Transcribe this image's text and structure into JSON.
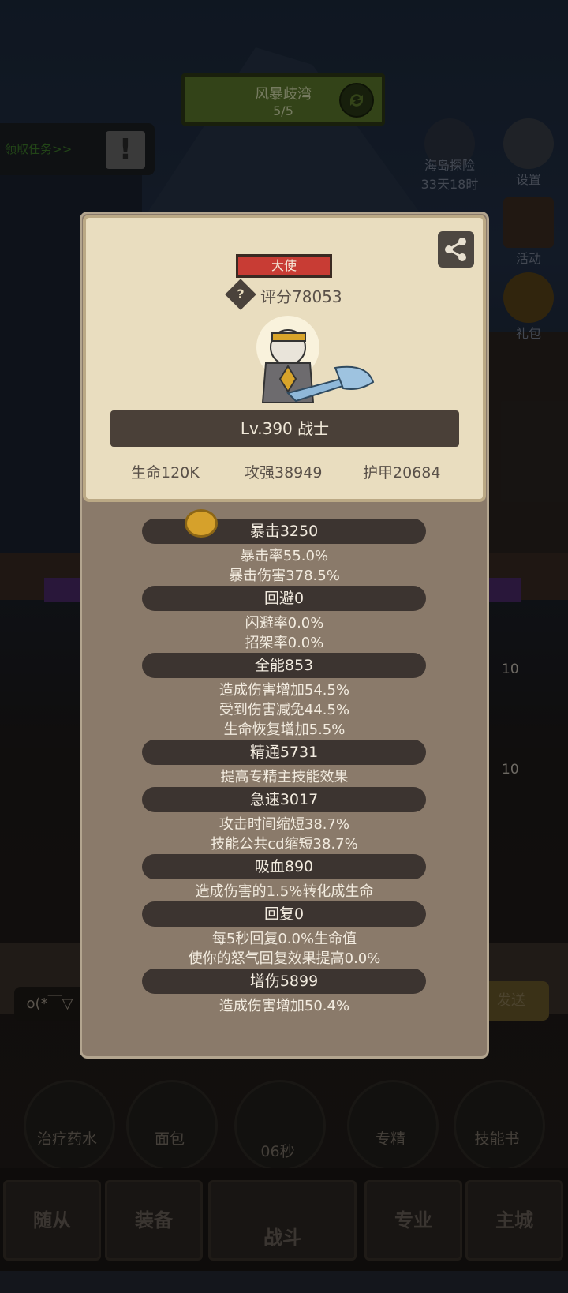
{
  "quest": {
    "title": "风暴歧湾",
    "progress": "5/5"
  },
  "task": {
    "label": "领取任务>>",
    "alert": "!"
  },
  "side_icons": [
    {
      "label": "海岛探险",
      "sub": "33天18时"
    },
    {
      "label": "设置"
    },
    {
      "label": "活动"
    },
    {
      "label": "礼包"
    }
  ],
  "card": {
    "rank": "大使",
    "score_help": "?",
    "score": "评分78053",
    "level": "Lv.390 战士",
    "base_stats": [
      "生命120K",
      "攻强38949",
      "护甲20684"
    ]
  },
  "stats": [
    {
      "title": "暴击3250",
      "lines": [
        "暴击率55.0%",
        "暴击伤害378.5%"
      ]
    },
    {
      "title": "回避0",
      "lines": [
        "闪避率0.0%",
        "招架率0.0%"
      ]
    },
    {
      "title": "全能853",
      "lines": [
        "造成伤害增加54.5%",
        "受到伤害减免44.5%",
        "生命恢复增加5.5%"
      ]
    },
    {
      "title": "精通5731",
      "lines": [
        "提高专精主技能效果"
      ]
    },
    {
      "title": "急速3017",
      "lines": [
        "攻击时间缩短38.7%",
        "技能公共cd缩短38.7%"
      ]
    },
    {
      "title": "吸血890",
      "lines": [
        "造成伤害的1.5%转化成生命"
      ]
    },
    {
      "title": "回复0",
      "lines": [
        "每5秒回复0.0%生命值",
        "使你的怒气回复效果提高0.0%"
      ]
    },
    {
      "title": "增伤5899",
      "lines": [
        "造成伤害增加50.4%"
      ]
    }
  ],
  "bottom_items": [
    "治疗药水",
    "面包",
    "06秒",
    "专精",
    "技能书"
  ],
  "nav_tabs": [
    "随从",
    "装备",
    "战斗",
    "专业",
    "主城"
  ],
  "background": {
    "chat_text": "o(*￣▽",
    "send_text": "发送",
    "badge_10": "10"
  },
  "colors": {
    "rank_red": "#c83c34",
    "pill_dark": "#3c3430",
    "card_bg": "#e9ddbf",
    "quest_green": "#5d7a2d"
  }
}
